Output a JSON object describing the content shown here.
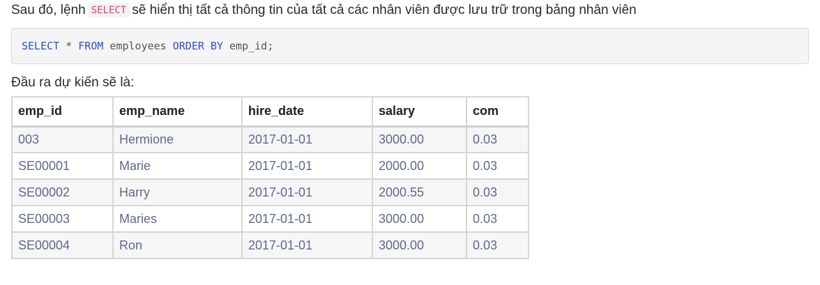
{
  "intro": {
    "before": "Sau đó, lệnh",
    "code": "SELECT",
    "after": "sẽ hiển thị tất cả thông tin của tất cả các nhân viên được lưu trữ trong bảng nhân viên"
  },
  "code_block": {
    "select": "SELECT",
    "star": " * ",
    "from": "FROM",
    "table": " employees ",
    "order": "ORDER BY",
    "rest": " emp_id;"
  },
  "output_label": "Đầu ra dự kiến sẽ là:",
  "table": {
    "headers": [
      "emp_id",
      "emp_name",
      "hire_date",
      "salary",
      "com"
    ],
    "rows": [
      [
        "003",
        "Hermione",
        "2017-01-01",
        "3000.00",
        "0.03"
      ],
      [
        "SE00001",
        "Marie",
        "2017-01-01",
        "2000.00",
        "0.03"
      ],
      [
        "SE00002",
        "Harry",
        "2017-01-01",
        "2000.55",
        "0.03"
      ],
      [
        "SE00003",
        "Maries",
        "2017-01-01",
        "3000.00",
        "0.03"
      ],
      [
        "SE00004",
        "Ron",
        "2017-01-01",
        "3000.00",
        "0.03"
      ]
    ]
  }
}
